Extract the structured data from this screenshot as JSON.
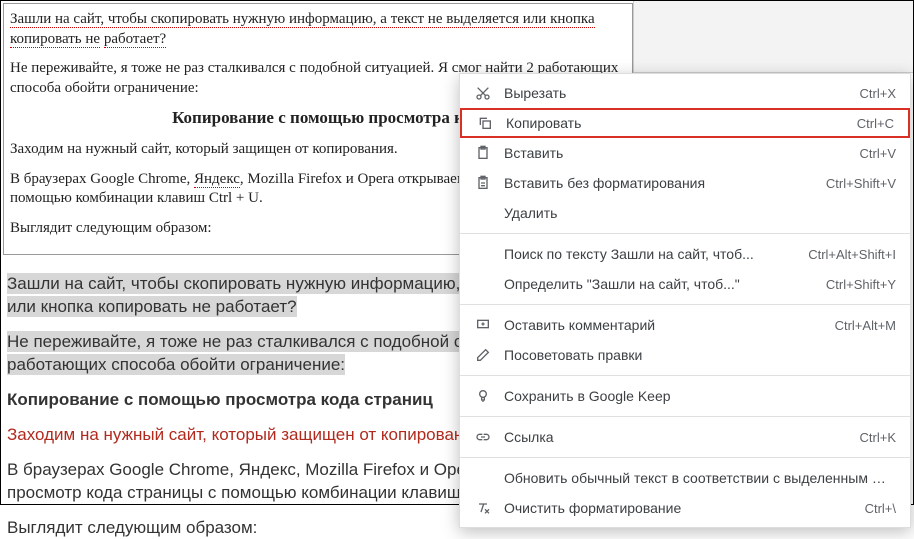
{
  "editor_top": {
    "p1_a": "Зашли на сайт, чтобы скопировать нужную информацию, а текст не выделяется или кнопка копировать не",
    "p1_b": "работает?",
    "p2": "Не переживайте, я тоже не раз сталкивался с подобной ситуацией. Я смог найти 2 работающих способа обойти ограничение:",
    "h2": "Копирование с помощью просмотра к",
    "p3": "Заходим на нужный сайт, который защищен от копирования.",
    "p4_a": "В браузерах Google Chrome, ",
    "p4_spell": "Яндекс",
    "p4_b": ", Mozilla Firefox и Opera открываем раздел",
    "p4_c": "помощью комбинации клавиш Ctrl + U.",
    "p5": "Выглядит следующим образом:"
  },
  "editor_bottom": {
    "p1_a": "Зашли на сайт, чтобы скопировать нужную информацию,",
    "p1_b": "или кнопка копировать не работает?",
    "p2_a": "Не переживайте, я тоже не раз сталкивался с подобной ситуац",
    "p2_b": "работающих способа обойти ограничение:",
    "p3": "Копирование с помощью просмотра кода страниц",
    "p4": "Заходим на нужный сайт, который защищен от копирован",
    "p5_a": "В браузерах Google Chrome, Яндекс, Mozilla Firefox и Оpe",
    "p5_b": "просмотр кода страницы с помощью комбинации клавиш",
    "p6": "Выглядит следующим образом:"
  },
  "menu": {
    "cut": {
      "label": "Вырезать",
      "shortcut": "Ctrl+X"
    },
    "copy": {
      "label": "Копировать",
      "shortcut": "Ctrl+C"
    },
    "paste": {
      "label": "Вставить",
      "shortcut": "Ctrl+V"
    },
    "paste_plain": {
      "label": "Вставить без форматирования",
      "shortcut": "Ctrl+Shift+V"
    },
    "delete": {
      "label": "Удалить",
      "shortcut": ""
    },
    "search": {
      "label": "Поиск по тексту Зашли на сайт, чтоб...",
      "shortcut": "Ctrl+Alt+Shift+I"
    },
    "define": {
      "label": "Определить \"Зашли на сайт, чтоб...\"",
      "shortcut": "Ctrl+Shift+Y"
    },
    "comment": {
      "label": "Оставить комментарий",
      "shortcut": "Ctrl+Alt+M"
    },
    "suggest": {
      "label": "Посоветовать правки",
      "shortcut": ""
    },
    "keep": {
      "label": "Сохранить в Google Keep",
      "shortcut": ""
    },
    "link": {
      "label": "Ссылка",
      "shortcut": "Ctrl+K"
    },
    "update_normal": {
      "label": "Обновить обычный текст в соответствии с выделенным фрагментом",
      "shortcut": ""
    },
    "clear_format": {
      "label": "Очистить форматирование",
      "shortcut": "Ctrl+\\"
    }
  }
}
